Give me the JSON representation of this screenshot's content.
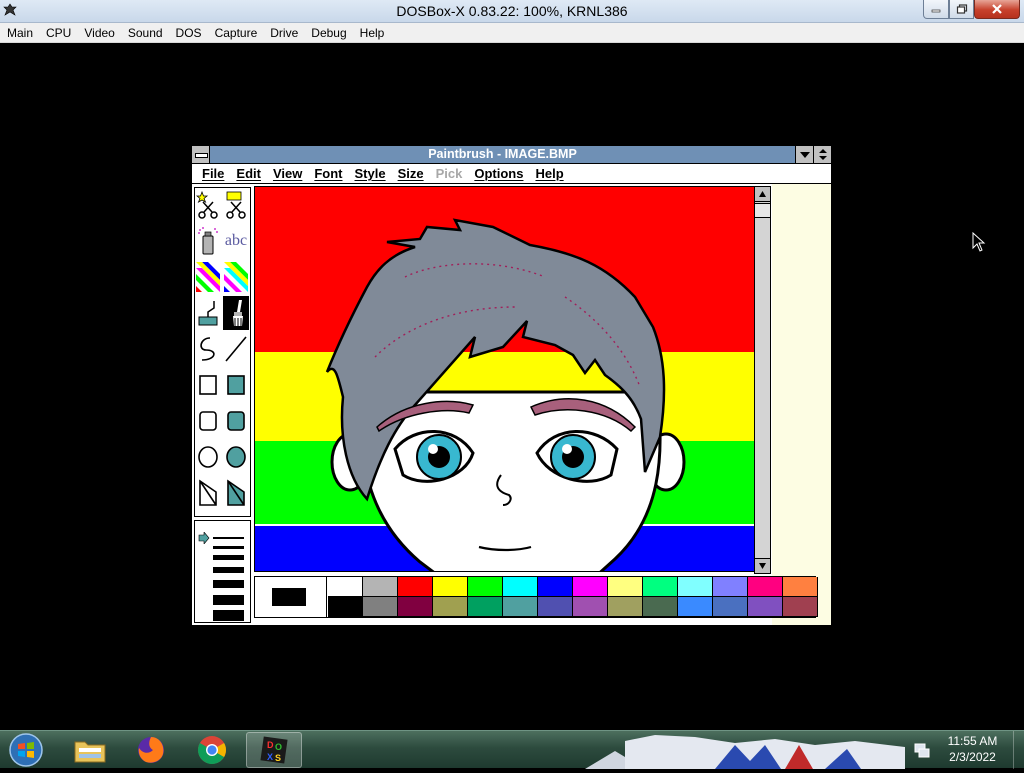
{
  "host_window": {
    "title": "DOSBox-X 0.83.22: 100%, KRNL386",
    "menu": [
      "Main",
      "CPU",
      "Video",
      "Sound",
      "DOS",
      "Capture",
      "Drive",
      "Debug",
      "Help"
    ]
  },
  "paintbrush": {
    "title": "Paintbrush - IMAGE.BMP",
    "menu": [
      {
        "label": "File",
        "enabled": true
      },
      {
        "label": "Edit",
        "enabled": true
      },
      {
        "label": "View",
        "enabled": true
      },
      {
        "label": "Font",
        "enabled": true
      },
      {
        "label": "Style",
        "enabled": true
      },
      {
        "label": "Size",
        "enabled": true
      },
      {
        "label": "Pick",
        "enabled": false
      },
      {
        "label": "Options",
        "enabled": true
      },
      {
        "label": "Help",
        "enabled": true
      }
    ],
    "tools": {
      "text_tool_glyph": "abc"
    },
    "current_colors": {
      "foreground": "#000000",
      "background": "#ffffff"
    },
    "palette_top": [
      "#ffffff",
      "#b4b4b4",
      "#ff0000",
      "#ffff00",
      "#00ff00",
      "#00ffff",
      "#0000ff",
      "#ff00ff",
      "#ffff80",
      "#00ff80",
      "#80ffff",
      "#8080ff",
      "#ff0080",
      "#ff8040"
    ],
    "palette_bottom": [
      "#000000",
      "#808080",
      "#800040",
      "#a0a050",
      "#00a060",
      "#50a0a0",
      "#5050b0",
      "#a050b0",
      "#a0a060",
      "#4a6a50",
      "#3a8aff",
      "#4a70c0",
      "#8050c0",
      "#a04050"
    ],
    "canvas_stripes": [
      "#ff0000",
      "#ffff00",
      "#00ff00",
      "#0000ff"
    ]
  },
  "taskbar": {
    "time": "11:55 AM",
    "date": "2/3/2022"
  }
}
